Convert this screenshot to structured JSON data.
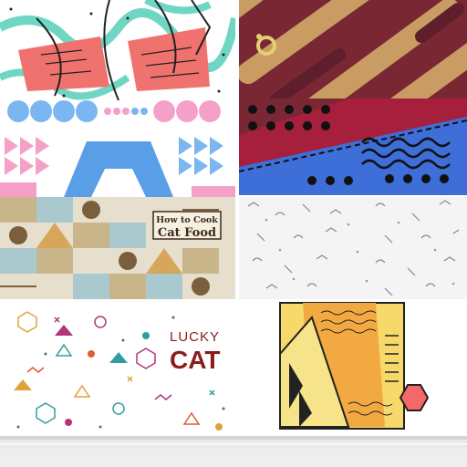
{
  "tiles": {
    "cat_food": {
      "line1": "How to Cook",
      "line2": "Cat Food"
    },
    "lucky_cat": {
      "line1": "LUCKY",
      "line2": "CAT"
    }
  },
  "colors": {
    "coral": "#f0726f",
    "teal": "#6fd6c4",
    "maroon": "#7a2734",
    "tan": "#c89c63",
    "blue_light": "#7bb6f0",
    "pink": "#f5a0c8",
    "royal_blue": "#3e6ed8",
    "crimson": "#a61f3c",
    "yellow": "#f6d86b",
    "orange": "#f3a941",
    "hex_red": "#f36868",
    "floor_gray": "#e6e6e6"
  }
}
